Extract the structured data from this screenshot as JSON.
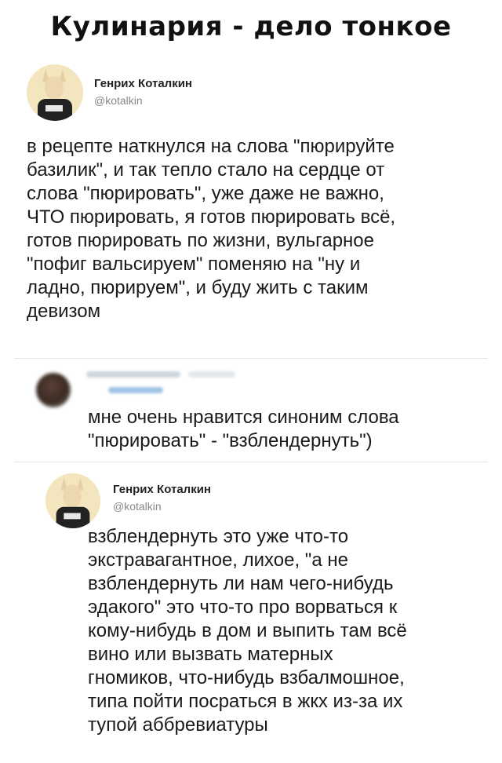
{
  "header": {
    "title": "Кулинария - дело тонкое"
  },
  "tweet_main": {
    "author_name": "Генрих Коталкин",
    "author_handle": "@kotalkin",
    "text": "в рецепте наткнулся на слова \"пюрируйте\nбазилик\", и так тепло стало на сердце от\nслова \"пюрировать\", уже даже не важно,\nЧТО пюрировать, я готов пюрировать всё,\nготов пюрировать по жизни, вульгарное\n\"пофиг вальсируем\" поменяю на \"ну и\nладно, пюрируем\", и буду жить с таким\nдевизом"
  },
  "tweet_reply": {
    "text": "мне очень нравится синоним слова\n\"пюрировать\" - \"взблендернуть\")"
  },
  "tweet_answer": {
    "author_name": "Генрих Коталкин",
    "author_handle": "@kotalkin",
    "text": "взблендернуть это уже что-то\nэкстравагантное, лихое, \"а не\nвзблендернуть ли нам чего-нибудь\nэдакого\" это что-то про ворваться к\nкому-нибудь в дом и выпить там всё\nвино или вызвать матерных\nгномиков, что-нибудь взбалмошное,\nтипа пойти посраться в жкх из-за их\nтупой аббревиатуры"
  }
}
